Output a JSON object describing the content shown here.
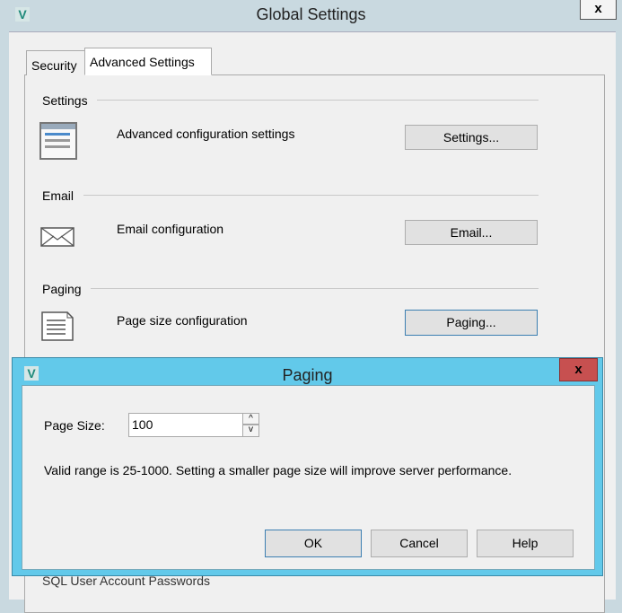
{
  "window": {
    "title": "Global Settings",
    "close": "x",
    "logo": "V"
  },
  "tabs": [
    {
      "label": "Security"
    },
    {
      "label": "Advanced Settings"
    }
  ],
  "groups": {
    "settings": {
      "heading": "Settings",
      "description": "Advanced configuration settings",
      "button": "Settings...",
      "icon": "list-window-icon"
    },
    "email": {
      "heading": "Email",
      "description": "Email configuration",
      "button": "Email...",
      "icon": "envelope-icon"
    },
    "paging": {
      "heading": "Paging",
      "description": "Page size configuration",
      "button": "Paging...",
      "icon": "document-icon"
    },
    "sql": {
      "heading": "SQL User Account Passwords"
    }
  },
  "dialog": {
    "title": "Paging",
    "close": "x",
    "logo": "V",
    "page_size_label": "Page Size:",
    "page_size_value": "100",
    "up": "^",
    "down": "v",
    "info": "Valid range is 25-1000.  Setting a smaller page size will improve server performance.",
    "ok": "OK",
    "cancel": "Cancel",
    "help": "Help"
  }
}
